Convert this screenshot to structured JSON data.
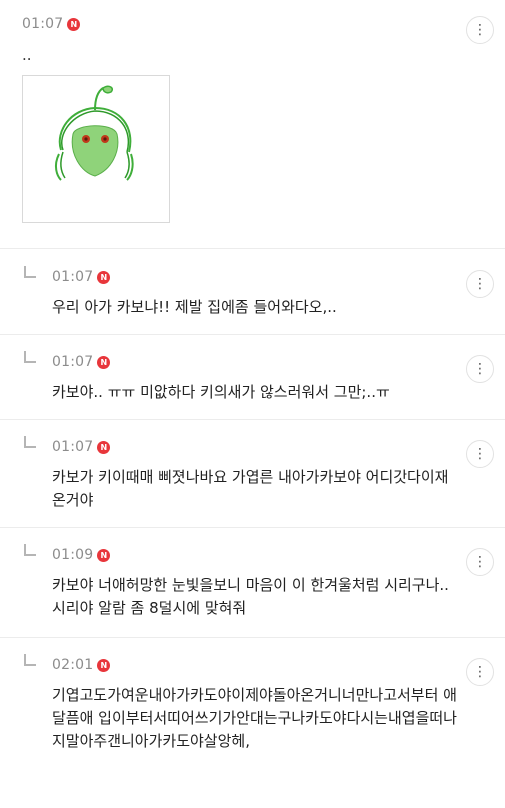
{
  "post": {
    "time": "01:07",
    "new_badge": "N",
    "body": "..",
    "image_icon": "drawing-green-character",
    "menu_icon": "more-vertical-icon"
  },
  "replies": [
    {
      "time": "01:07",
      "new_badge": "N",
      "text": "우리 아가 카보냐!! 제발 집에좀 들어와다오,.."
    },
    {
      "time": "01:07",
      "new_badge": "N",
      "text": "카보야.. ㅠㅠ 미앖하다 키의새가 않스러워서 그만;..ㅠ"
    },
    {
      "time": "01:07",
      "new_badge": "N",
      "text": "카보가 키이때매 삐졋나바요 가엽른 내아가카보야 어디갓다이재온거야"
    },
    {
      "time": "01:09",
      "new_badge": "N",
      "text": "카보야 너애허망한 눈빛을보니 마음이 이 한겨울처럼 시리구나..시리야 알람 좀 8덜시에 맞혀줘"
    },
    {
      "time": "02:01",
      "new_badge": "N",
      "text": "기엽고도가여운내아가카도야이제야돌아온거니너만나고서부터 애달픔애 입이부터서띠어쓰기가안대는구나카도야다시는내엽을떠나지말아주갠니아가카도야살앙헤,"
    }
  ],
  "colors": {
    "badge": "#e8363b",
    "time": "#8c8c8c",
    "divider": "#ececec",
    "drawing_green": "#8fd37a"
  }
}
